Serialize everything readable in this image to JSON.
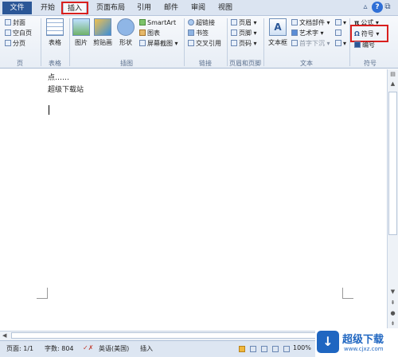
{
  "tabs": {
    "file": "文件",
    "home": "开始",
    "insert": "插入",
    "layout": "页面布局",
    "references": "引用",
    "mailings": "邮件",
    "review": "审阅",
    "view": "视图"
  },
  "ribbon": {
    "pages": {
      "cover": "封面",
      "blank": "空白页",
      "break": "分页",
      "label": "页"
    },
    "tables": {
      "table": "表格",
      "label": "表格"
    },
    "illustrations": {
      "picture": "图片",
      "clipart": "剪贴画",
      "shapes": "形状",
      "smartart": "SmartArt",
      "chart": "图表",
      "screenshot": "屏幕截图",
      "label": "插图"
    },
    "links": {
      "hyperlink": "超链接",
      "bookmark": "书签",
      "crossref": "交叉引用",
      "label": "链接"
    },
    "header_footer": {
      "header": "页眉",
      "footer": "页脚",
      "page_number": "页码",
      "label": "页眉和页脚"
    },
    "text": {
      "textbox": "文本框",
      "quickparts": "文档部件",
      "wordart": "艺术字",
      "dropcap": "首字下沉",
      "label": "文本"
    },
    "symbols": {
      "equation": "公式",
      "symbol": "符号",
      "number": "编号",
      "label": "符号"
    }
  },
  "document": {
    "line1": "点……",
    "line2": "超级下载站"
  },
  "status": {
    "page": "页面: 1/1",
    "words": "字数: 804",
    "language": "英语(美国)",
    "mode": "插入",
    "zoom": "100%"
  },
  "watermark": {
    "text": "超级下载",
    "url": "www.cjxz.com"
  }
}
